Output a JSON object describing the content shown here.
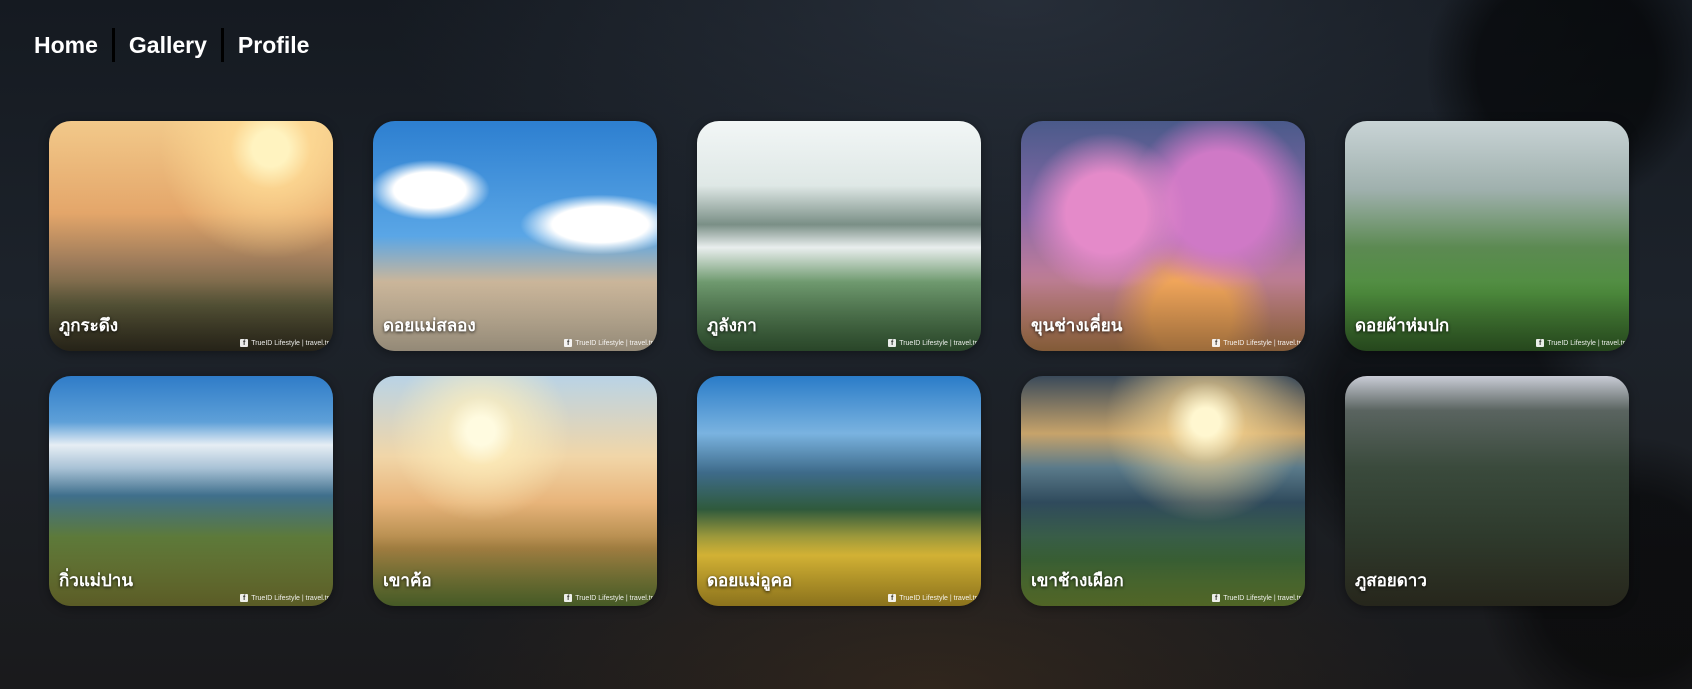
{
  "nav": {
    "home": "Home",
    "gallery": "Gallery",
    "profile": "Profile"
  },
  "cards": [
    {
      "name": "ภูกระดึง",
      "credit": "TrueID Lifestyle | travel.tr"
    },
    {
      "name": "ดอยแม่สลอง",
      "credit": "TrueID Lifestyle | travel.tr"
    },
    {
      "name": "ภูลังกา",
      "credit": "TrueID Lifestyle | travel.tr"
    },
    {
      "name": "ขุนช่างเคี่ยน",
      "credit": "TrueID Lifestyle | travel.tr"
    },
    {
      "name": "ดอยผ้าห่มปก",
      "credit": "TrueID Lifestyle | travel.tr"
    },
    {
      "name": "กิ่วแม่ปาน",
      "credit": "TrueID Lifestyle | travel.tr"
    },
    {
      "name": "เขาค้อ",
      "credit": "TrueID Lifestyle | travel.tr"
    },
    {
      "name": "ดอยแม่อูคอ",
      "credit": "TrueID Lifestyle | travel.tr"
    },
    {
      "name": "เขาช้างเผือก",
      "credit": "TrueID Lifestyle | travel.tr"
    },
    {
      "name": "ภูสอยดาว",
      "credit": ""
    }
  ]
}
